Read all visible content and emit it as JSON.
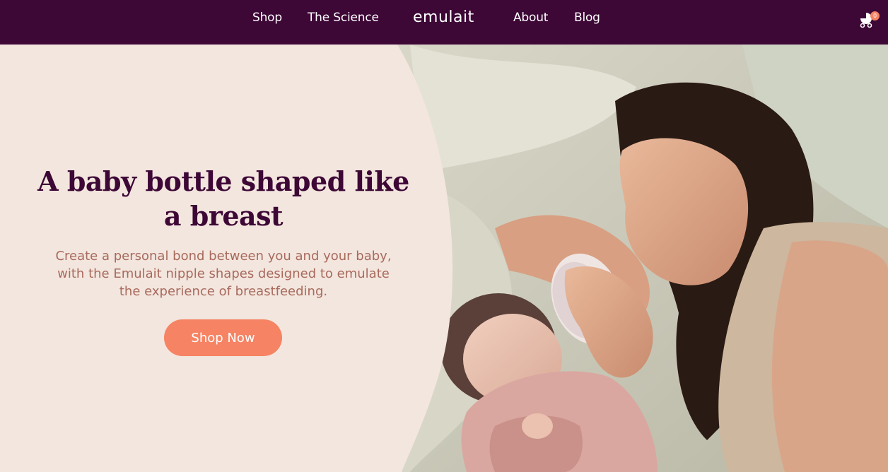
{
  "nav": {
    "items": [
      {
        "label": "Shop"
      },
      {
        "label": "The Science"
      },
      {
        "label": "About"
      },
      {
        "label": "Blog"
      }
    ],
    "logo": "emulait",
    "cart_count": "0"
  },
  "hero": {
    "headline": "A baby bottle shaped like a breast",
    "subtext": "Create a personal bond between you and your baby, with the Emulait nipple shapes designed to emulate the experience of breastfeeding.",
    "cta_label": "Shop Now"
  },
  "colors": {
    "brand_plum": "#3d0736",
    "background_cream": "#f3e6de",
    "accent_coral": "#f68363",
    "subtext_rose": "#a86a5d"
  },
  "icons": {
    "cart": "stroller-icon"
  }
}
